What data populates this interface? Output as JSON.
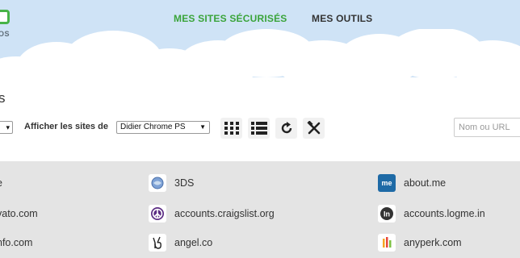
{
  "header": {
    "logo_text": "OS",
    "nav": [
      {
        "label": "MES SITES SÉCURISÉS",
        "active": true
      },
      {
        "label": "MES OUTILS",
        "active": false
      }
    ]
  },
  "page": {
    "title_fragment": "s"
  },
  "toolbar": {
    "filter_label": "Afficher les sites de",
    "selected_user": "Didier Chrome PS",
    "search_placeholder": "Nom ou URL"
  },
  "sites": {
    "col1": [
      "e",
      "vato.com",
      "nfo.com"
    ],
    "col2": [
      "3DS",
      "accounts.craigslist.org",
      "angel.co"
    ],
    "col3": [
      "about.me",
      "accounts.logme.in",
      "anyperk.com"
    ]
  },
  "colors": {
    "accent_green": "#3aa43a",
    "sky": "#cfe3f6",
    "grid_bg": "#e4e4e4"
  }
}
